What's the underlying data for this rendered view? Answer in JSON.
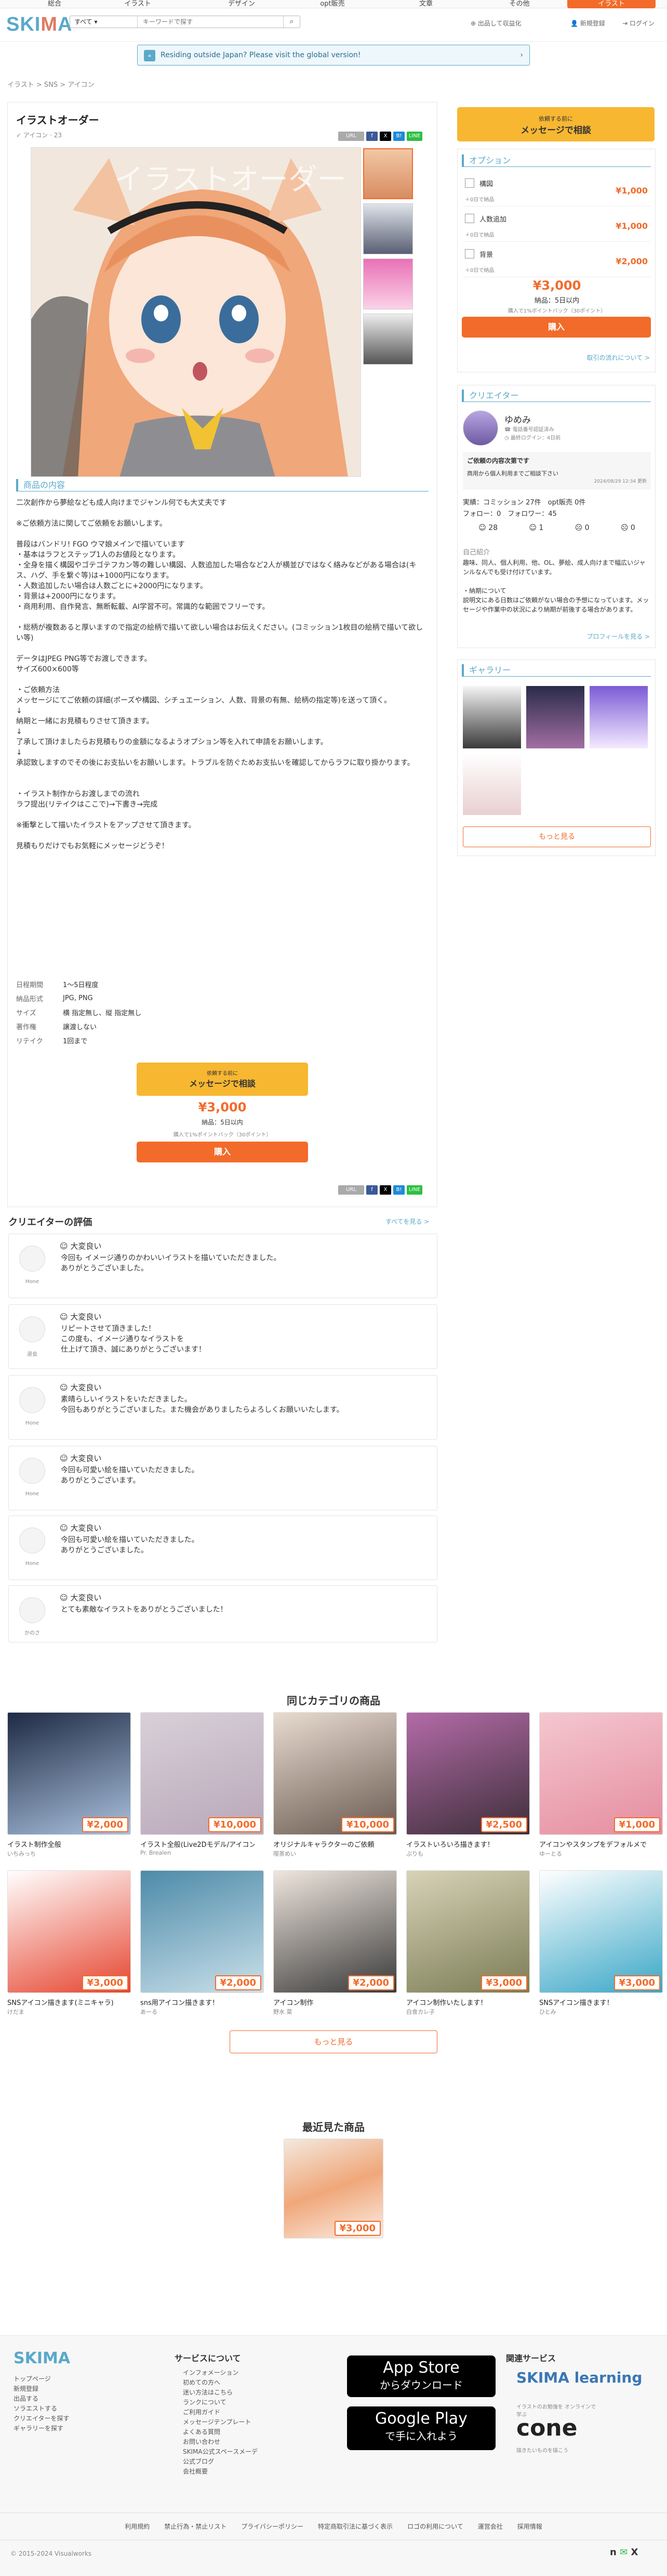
{
  "topnav": [
    "総合",
    "イラスト",
    "デザイン",
    "opt販売",
    "文章",
    "その他"
  ],
  "header": {
    "logo": "SKIMA",
    "search_select": "すべて",
    "search_placeholder": "キーワードで探す",
    "links": [
      "出品して収益化",
      "新規登録",
      "ログイン"
    ],
    "cta": "出品して収益化"
  },
  "banner": "Residing outside Japan? Please visit the global version!",
  "breadcrumb": [
    "イラスト",
    "SNS",
    "アイコン"
  ],
  "product": {
    "title": "イラストオーダー",
    "subtitle": "アイコン · 23",
    "image_text": "イラストオーダー",
    "section_title": "商品の内容",
    "description": "二次創作から夢絵なども成人向けまでジャンル何でも大丈夫です\n\n※ご依頼方法に関してご依頼をお願いします。\n\n普段はバンドリ! FGO ウマ娘メインで描いています\n・基本はラフとステップ1人のお値段となります。\n・全身を描く構図やゴテゴテフカン等の難しい構図、人数追加した場合など2人が横並びではなく絡みなどがある場合は(キス、ハグ、手を繋ぐ等)は+1000円になります。\n・人数追加したい場合は人数ごとに+2000円になります。\n・背景は+2000円になります。\n・商用利用、自作発言、無断転載、AI学習不可。常識的な範囲でフリーです。\n\n・総柄が複数あると厚いますので指定の絵柄で描いて欲しい場合はお伝えください。(コミッション1枚目の絵柄で描いて欲しい等)\n\nデータはJPEG PNG等でお渡しできます。\nサイズ600×600等\n\n・ご依頼方法\nメッセージにてご依頼の詳細(ポーズや構図、シチュエーション、人数、背景の有無、絵柄の指定等)を送って頂く。\n↓\n納期と一緒にお見積もりさせて頂きます。\n↓\n了承して頂けましたらお見積もりの金額になるようオプション等を入れて申請をお願いします。\n↓\n承認致しますのでその後にお支払いをお願いします。トラブルを防ぐためお支払いを確認してからラフに取り掛かります。\n\n\n・イラスト制作からお渡しまでの流れ\nラフ提出(リテイクはここで)→下書き→完成\n\n※衝撃として描いたイラストをアップさせて頂きます。\n\n見積もりだけでもお気軽にメッセージどうぞ！",
    "specs": [
      {
        "k": "日程期間",
        "v": "1〜5日程度"
      },
      {
        "k": "納品形式",
        "v": "JPG, PNG"
      },
      {
        "k": "サイズ",
        "v": "横 指定無し、縦 指定無し"
      },
      {
        "k": "著作権",
        "v": "譲渡しない"
      },
      {
        "k": "リテイク",
        "v": "1回まで"
      }
    ],
    "consult_small": "依頼する前に",
    "consult_label": "メッセージで相談",
    "price": "¥3,000",
    "delivery": "納品：5日以内",
    "points": "購入で1%ポイントバック（30ポイント）",
    "buy_label": "購入",
    "share": [
      "URL",
      "f",
      "X",
      "B!",
      "LINE"
    ]
  },
  "sidebar": {
    "consult_small": "依頼する前に",
    "consult_label": "メッセージで相談",
    "options_title": "オプション",
    "options": [
      {
        "name": "構図",
        "price": "¥1,000",
        "sub": "＋0日で納品"
      },
      {
        "name": "人数追加",
        "price": "¥1,000",
        "sub": "＋0日で納品"
      },
      {
        "name": "背景",
        "price": "¥2,000",
        "sub": "＋0日で納品"
      }
    ],
    "price": "¥3,000",
    "delivery": "納品：5日以内",
    "points": "購入で1%ポイントバック（30ポイント）",
    "buy_label": "購入",
    "flow_link": "取引の流れについて >",
    "creator_title": "クリエイター",
    "creator_name": "ゆめみ",
    "creator_badge1": "電話番号認証済み",
    "creator_badge2": "最終ログイン：4日前",
    "notice_title": "ご依頼の内容次第です",
    "notice_text": "商用から個人利用までご相談下さい",
    "notice_date": "2024/08/29 12:34 更新",
    "stats": "実績：コミッション 27件　opt販売 0件",
    "follow": "フォロー：0　フォロワー：45",
    "ratings": [
      "28",
      "1",
      "0",
      "0"
    ],
    "intro_title": "自己紹介",
    "intro_text": "趣味、同人、個人利用、他、OL、夢絵、成人向けまで幅広いジャンルなんでも受け付けています。\n\n・納期について\n説明文にある日数はご依頼がない場合の予想になっています。メッセージや作業中の状況により納期が前後する場合があります。",
    "profile_link": "プロフィールを見る >",
    "gallery_title": "ギャラリー",
    "more_label": "もっと見る"
  },
  "reviews": {
    "title": "クリエイターの評価",
    "all_link": "すべてを見る >",
    "items": [
      {
        "rating": "大変良い",
        "user": "Hone",
        "text": "今回も イメージ通りのかわいいイラストを描いていただきました。\nありがとうございました。"
      },
      {
        "rating": "大変良い",
        "user": "退会",
        "text": "リピートさせて頂きました！\nこの度も、イメージ通りなイラストを\n仕上げて頂き、誠にありがとうございます！"
      },
      {
        "rating": "大変良い",
        "user": "Hone",
        "text": "素晴らしいイラストをいただきました。\n今回もありがとうございました。また機会がありましたらよろしくお願いいたします。"
      },
      {
        "rating": "大変良い",
        "user": "Hone",
        "text": "今回も可愛い絵を描いていただきました。\nありがとうございます。"
      },
      {
        "rating": "大変良い",
        "user": "Hone",
        "text": "今回も可愛い絵を描いていただきました。\nありがとうございました。"
      },
      {
        "rating": "大変良い",
        "user": "かのさ",
        "text": "とても素敵なイラストをありがとうございました！"
      }
    ]
  },
  "similar": {
    "title": "同じカテゴリの商品",
    "items": [
      {
        "title": "イラスト制作全般",
        "name": "いちみっち",
        "price": "¥2,000",
        "c1": "#1f2a44",
        "c2": "#a9c1dd"
      },
      {
        "title": "イラスト全般(Live2Dモデル/アイコン等)",
        "name": "Pr. Brealen",
        "price": "¥10,000",
        "c1": "#d8d0d8",
        "c2": "#b9a7b9"
      },
      {
        "title": "オリジナルキャラクターのご依頼",
        "name": "喫茶めい",
        "price": "¥10,000",
        "c1": "#e8dbd0",
        "c2": "#6a5a51"
      },
      {
        "title": "イラストいろいろ描きます！",
        "name": "ぷりも",
        "price": "¥2,500",
        "c1": "#b36ba8",
        "c2": "#3e2f3a"
      },
      {
        "title": "アイコンやスタンプをデフォルメで",
        "name": "ゆーとる",
        "price": "¥1,000",
        "c1": "#f4c7cf",
        "c2": "#e58d9f"
      },
      {
        "title": "SNSアイコン描きます(ミニキャラ)",
        "name": "けだま",
        "price": "¥3,000",
        "c1": "#ffffff",
        "c2": "#e64530"
      },
      {
        "title": "sns用アイコン描きます！",
        "name": "あーる",
        "price": "¥2,000",
        "c1": "#4d8aa8",
        "c2": "#c9e0ea"
      },
      {
        "title": "アイコン制作",
        "name": "野水 菜",
        "price": "¥2,000",
        "c1": "#efe6de",
        "c2": "#3a3a3a"
      },
      {
        "title": "アイコン制作いたします！",
        "name": "白食カレ子",
        "price": "¥3,000",
        "c1": "#d8d2b8",
        "c2": "#7b7d55"
      },
      {
        "title": "SNSアイコン描きます！",
        "name": "ひとみ",
        "price": "¥3,000",
        "c1": "#ffffff",
        "c2": "#3aa7c7"
      }
    ],
    "more_label": "もっと見る"
  },
  "recent": {
    "title": "最近見た商品",
    "price": "¥3,000"
  },
  "footer": {
    "logo": "SKIMA",
    "col1": [
      "トップページ",
      "新規登録",
      "出品する",
      "ソラエストする",
      "クリエイターを探す",
      "ギャラリーを探す"
    ],
    "col2_title": "サービスについて",
    "col2": [
      "インフォメーション",
      "初めての方へ",
      "迷い方法はこちら",
      "ランクについて",
      "ご利用ガイド",
      "メッセージテンプレート",
      "よくある質問",
      "お問い合わせ",
      "SKIMA公式スペースメーデ",
      "公式ブログ",
      "会社概要"
    ],
    "appstore_small": "App Store",
    "appstore_label": "からダウンロード",
    "google_small": "Google Play",
    "google_label": "で手に入れよう",
    "col3_title": "関連サービス",
    "learning": "SKIMA learning",
    "learning_sub": "イラストのお勉強を オンラインで学ぶ",
    "cone": "cone",
    "cone_sub": "描きたいものを描こう",
    "bottom_links": [
      "利用規約",
      "禁止行為・禁止リスト",
      "プライバシーポリシー",
      "特定商取引法に基づく表示",
      "ロゴの利用について",
      "運営会社",
      "採用情報"
    ],
    "copyright": "© 2015-2024 Visualworks"
  }
}
